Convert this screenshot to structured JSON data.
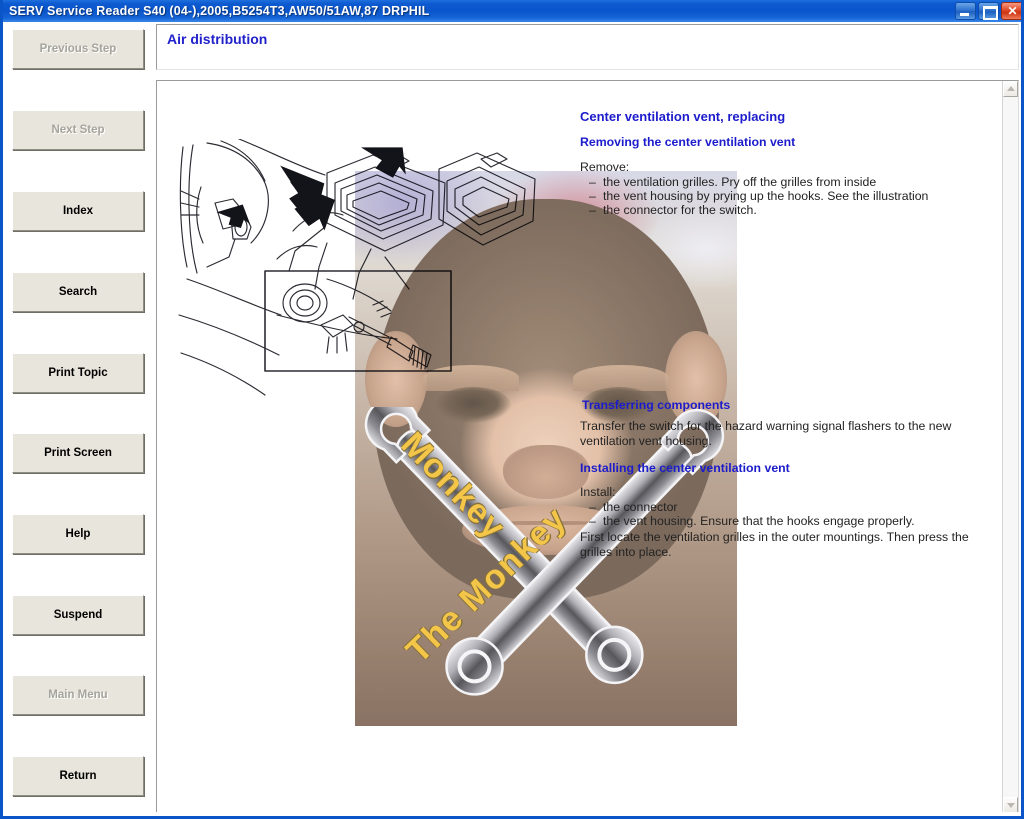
{
  "window": {
    "title": "SERV Service Reader S40 (04-),2005,B5254T3,AW50/51AW,87 DRPHIL",
    "controls": {
      "minimize": "minimize-button",
      "maximize": "maximize-button",
      "close": "close-button"
    }
  },
  "sidebar": {
    "buttons": [
      {
        "label": "Previous Step",
        "enabled": false
      },
      {
        "label": "Next Step",
        "enabled": false
      },
      {
        "label": "Index",
        "enabled": true
      },
      {
        "label": "Search",
        "enabled": true
      },
      {
        "label": "Print Topic",
        "enabled": true
      },
      {
        "label": "Print Screen",
        "enabled": true
      },
      {
        "label": "Help",
        "enabled": true
      },
      {
        "label": "Suspend",
        "enabled": true
      },
      {
        "label": "Main Menu",
        "enabled": false
      },
      {
        "label": "Return",
        "enabled": true
      }
    ]
  },
  "header": {
    "topic_title": "Air distribution"
  },
  "document": {
    "heading_main": "Center ventilation vent, replacing",
    "heading_removing": "Removing the center ventilation vent",
    "remove_label": "Remove:",
    "remove_items": [
      "the ventilation grilles. Pry off the grilles from inside",
      "the vent housing by prying up the hooks. See the illustration",
      "the connector for the switch."
    ],
    "heading_transferring": "Transferring components",
    "transfer_paragraph": "Transfer the switch for the hazard warning signal flashers to the new ventilation vent housing.",
    "heading_installing": "Installing the center ventilation vent",
    "install_label": "Install:",
    "install_items": [
      "the connector",
      "the vent housing. Ensure that the hooks engage properly."
    ],
    "install_paragraph": "First locate the ventilation grilles in the outer mountings. Then press the grilles into place."
  },
  "overlay_watermark": {
    "text_line_1": "Monkey",
    "text_line_2": "The Monkey",
    "description": "chimpanzee-photo-with-crossed-wrenches"
  },
  "scrollbar": {
    "up_arrow": "scroll-up-arrow",
    "down_arrow": "scroll-down-arrow"
  },
  "colors": {
    "titlebar_blue": "#0a55cb",
    "heading_blue": "#1c1ccc",
    "button_face": "#e8e5dc",
    "disabled_text": "#a5a49c",
    "watermark_yellow": "#f0b81c"
  }
}
